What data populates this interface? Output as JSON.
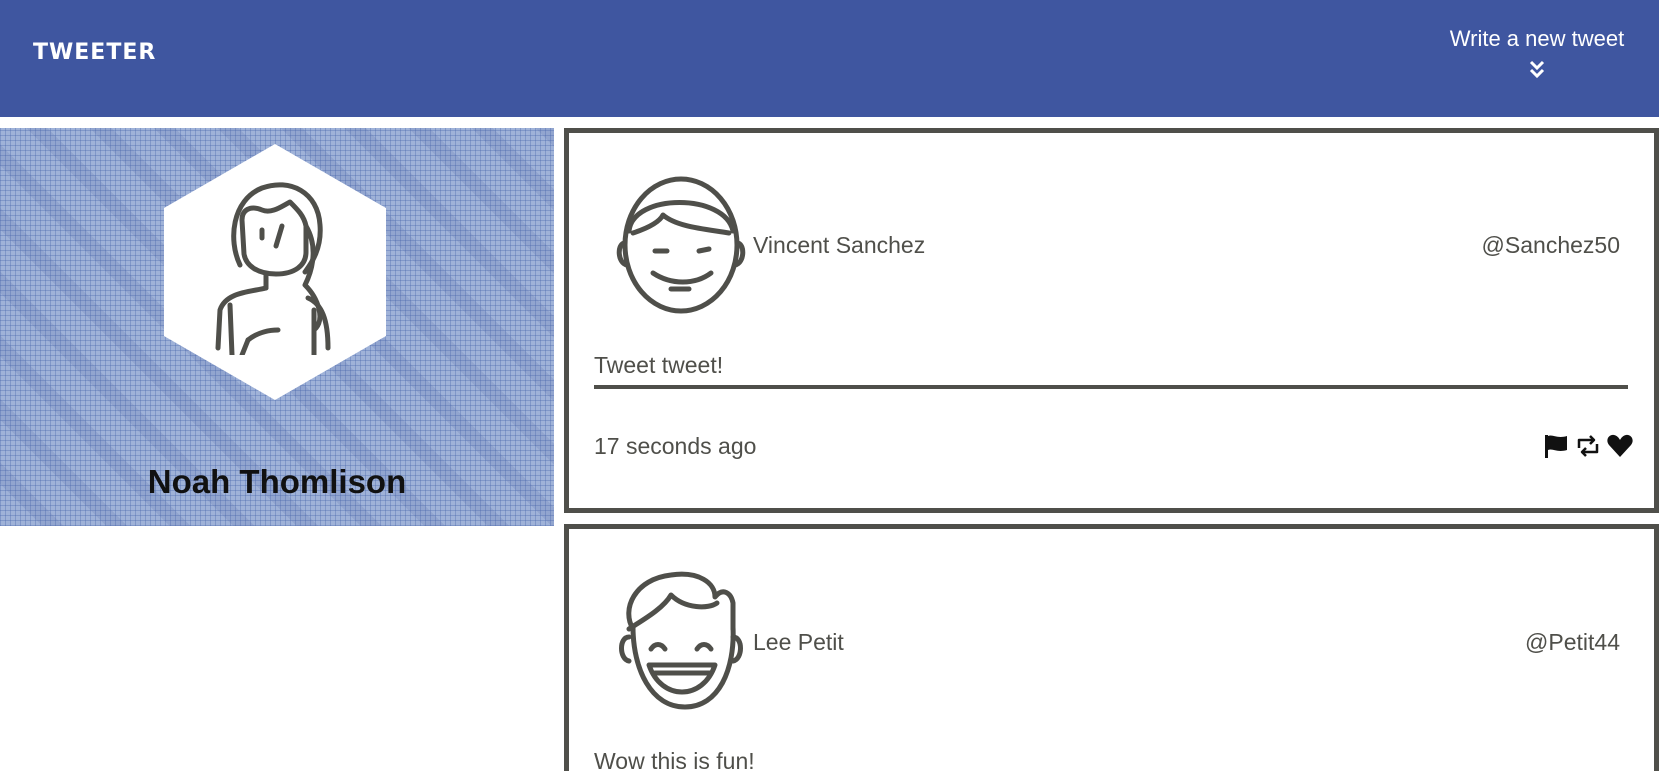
{
  "nav": {
    "brand": "TWEETER",
    "compose_label": "Write a new tweet",
    "compose_icon": "double-chevron-down-icon"
  },
  "profile": {
    "name": "Noah Thomlison",
    "avatar_icon": "woman-avatar-icon"
  },
  "tweets": [
    {
      "name": "Vincent Sanchez",
      "handle": "@Sanchez50",
      "text": "Tweet tweet!",
      "time": "17 seconds ago",
      "avatar_icon": "man-avatar-icon",
      "actions": [
        "flag-icon",
        "retweet-icon",
        "heart-icon"
      ]
    },
    {
      "name": "Lee Petit",
      "handle": "@Petit44",
      "text": "Wow this is fun!",
      "avatar_icon": "laughing-man-avatar-icon"
    }
  ],
  "colors": {
    "nav_background": "#3f56a0",
    "text": "#4f4f4a",
    "border": "#4f4f4a",
    "profile_background": "#9fb2d8"
  }
}
